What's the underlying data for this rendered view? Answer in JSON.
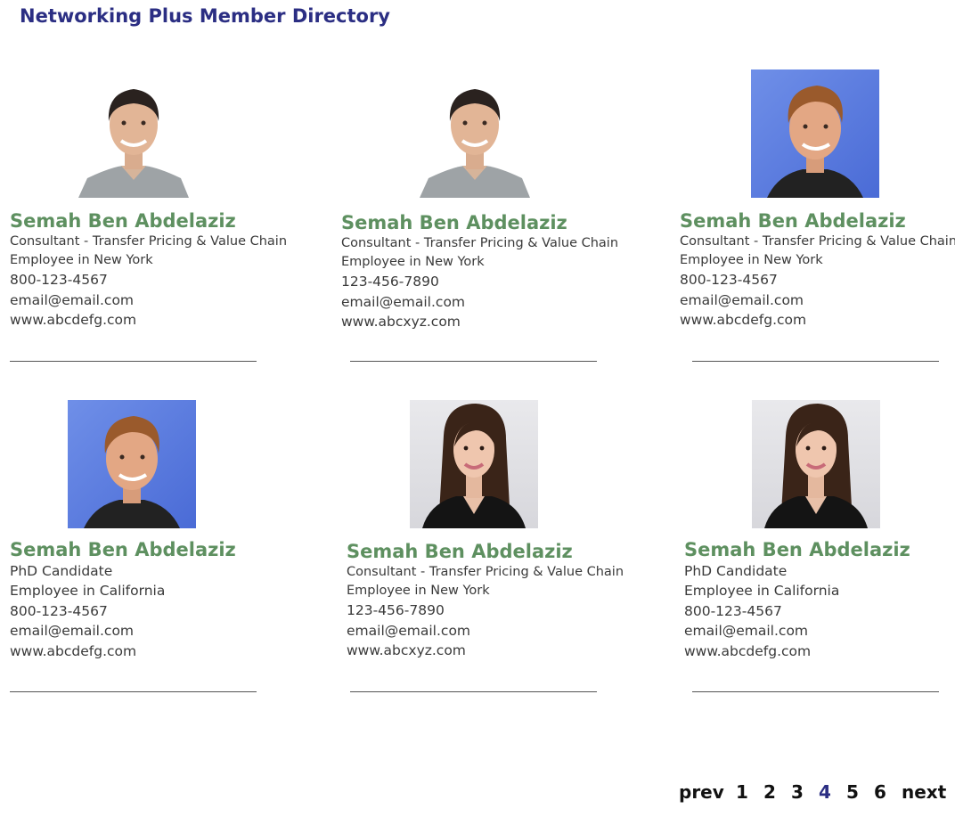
{
  "page_title": "Networking Plus Member Directory",
  "members": [
    {
      "name": "Semah Ben Abdelaziz",
      "title": "Consultant - Transfer Pricing & Value Chain",
      "location": "Employee in New York",
      "phone": "800-123-4567",
      "email": "email@email.com",
      "website": "www.abcdefg.com",
      "photo": "man-gray-shirt-photo"
    },
    {
      "name": "Semah Ben Abdelaziz",
      "title": "Consultant - Transfer Pricing & Value Chain",
      "location": "Employee in New York",
      "phone": "123-456-7890",
      "email": "email@email.com",
      "website": "www.abcxyz.com",
      "photo": "man-gray-shirt-photo"
    },
    {
      "name": "Semah Ben Abdelaziz",
      "title": "Consultant - Transfer Pricing & Value Chain",
      "location": "Employee in New York",
      "phone": "800-123-4567",
      "email": "email@email.com",
      "website": "www.abcdefg.com",
      "photo": "man-blue-background-photo"
    },
    {
      "name": "Semah Ben Abdelaziz",
      "title": "PhD Candidate",
      "location": "Employee in California",
      "phone": "800-123-4567",
      "email": "email@email.com",
      "website": "www.abcdefg.com",
      "photo": "man-blue-background-photo"
    },
    {
      "name": "Semah Ben Abdelaziz",
      "title": "Consultant - Transfer Pricing & Value Chain",
      "location": "Employee in New York",
      "phone": "123-456-7890",
      "email": "email@email.com",
      "website": "www.abcxyz.com",
      "photo": "woman-dark-hair-photo"
    },
    {
      "name": "Semah Ben Abdelaziz",
      "title": "PhD Candidate",
      "location": "Employee in California",
      "phone": "800-123-4567",
      "email": "email@email.com",
      "website": "www.abcdefg.com",
      "photo": "woman-dark-hair-photo"
    }
  ],
  "pagination": {
    "prev": "prev",
    "pages": [
      "1",
      "2",
      "3",
      "4",
      "5",
      "6"
    ],
    "current": "4",
    "next": "next"
  },
  "colors": {
    "title": "#2b2e83",
    "member_name": "#5e9060",
    "body_text": "#3a3a3a",
    "current_page": "#2b2e83"
  }
}
